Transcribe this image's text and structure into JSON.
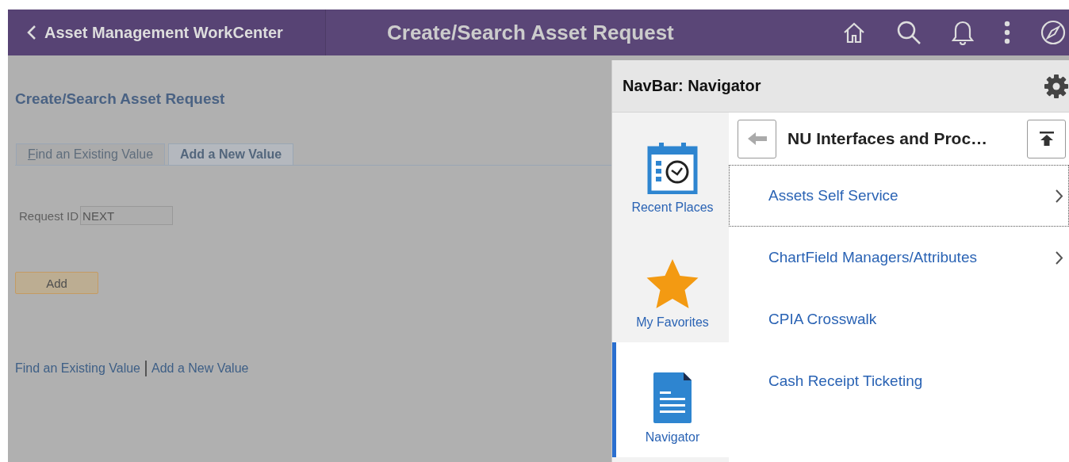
{
  "header": {
    "back_label": "Asset Management WorkCenter",
    "title": "Create/Search Asset Request"
  },
  "page": {
    "heading": "Create/Search Asset Request",
    "tabs": [
      {
        "label": "Find an Existing Value",
        "selected": false
      },
      {
        "label": "Add a New Value",
        "selected": true
      }
    ],
    "field": {
      "label": "Request ID",
      "value": "NEXT"
    },
    "add_button": "Add",
    "links": [
      "Find an Existing Value",
      "Add a New Value"
    ]
  },
  "navbar": {
    "title": "NavBar: Navigator",
    "tiles": [
      {
        "kind": "recent",
        "label": "Recent Places",
        "selected": false
      },
      {
        "kind": "favorites",
        "label": "My Favorites",
        "selected": false
      },
      {
        "kind": "navigator",
        "label": "Navigator",
        "selected": true
      }
    ],
    "folder": "NU Interfaces and Proc…",
    "items": [
      {
        "label": "Assets Self Service",
        "has_children": true,
        "focused": true
      },
      {
        "label": "ChartField Managers/Attributes",
        "has_children": true,
        "focused": false
      },
      {
        "label": "CPIA Crosswalk",
        "has_children": false,
        "focused": false
      },
      {
        "label": "Cash Receipt Ticketing",
        "has_children": false,
        "focused": false
      }
    ]
  }
}
